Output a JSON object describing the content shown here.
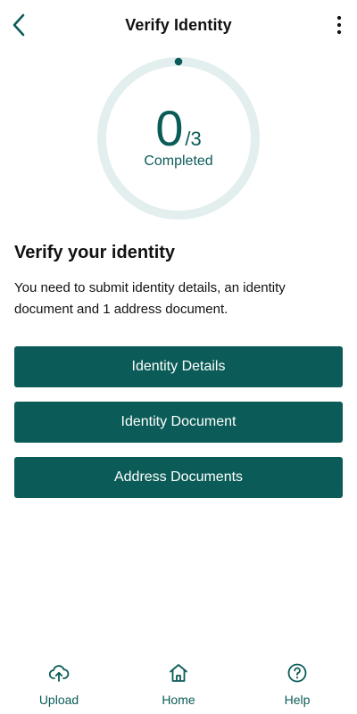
{
  "colors": {
    "primary": "#0b5c58",
    "ring_track": "#e2efee",
    "text": "#111111",
    "background": "#ffffff"
  },
  "header": {
    "title": "Verify Identity",
    "back_icon": "chevron-left-icon",
    "more_icon": "more-vertical-icon"
  },
  "progress": {
    "completed": "0",
    "total": "/3",
    "label": "Completed",
    "fraction": 0
  },
  "main": {
    "heading": "Verify your identity",
    "description": "You need to submit identity details, an identity document and 1 address document.",
    "buttons": [
      {
        "label": "Identity Details"
      },
      {
        "label": "Identity Document"
      },
      {
        "label": "Address Documents"
      }
    ]
  },
  "bottom_nav": {
    "items": [
      {
        "label": "Upload",
        "icon": "cloud-upload-icon"
      },
      {
        "label": "Home",
        "icon": "home-icon"
      },
      {
        "label": "Help",
        "icon": "help-circle-icon"
      }
    ]
  }
}
